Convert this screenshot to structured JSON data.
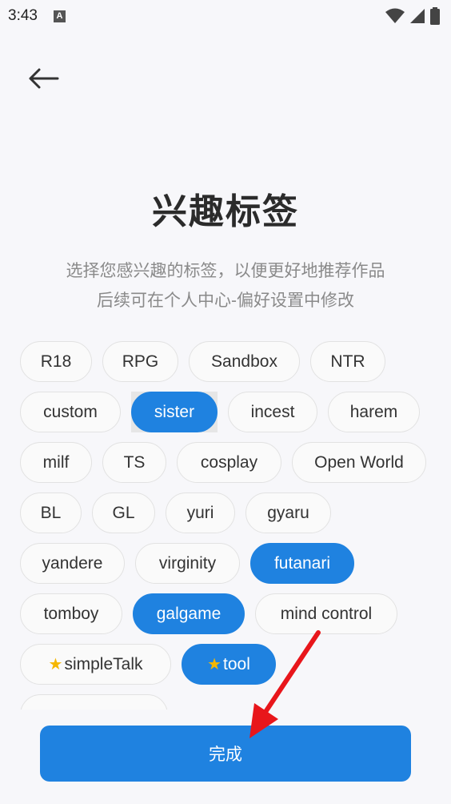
{
  "status": {
    "time": "3:43",
    "a_badge": "A"
  },
  "page": {
    "title": "兴趣标签",
    "subtitle_line1": "选择您感兴趣的标签，以便更好地推荐作品",
    "subtitle_line2": "后续可在个人中心-偏好设置中修改"
  },
  "tags": {
    "row1": [
      "R18",
      "RPG",
      "Sandbox",
      "NTR"
    ],
    "row2": [
      "custom",
      "sister",
      "incest",
      "harem"
    ],
    "row3": [
      "milf",
      "TS",
      "cosplay",
      "Open World"
    ],
    "row4": [
      "BL",
      "GL",
      "yuri",
      "gyaru"
    ],
    "row5": [
      "yandere",
      "virginity",
      "futanari"
    ],
    "row6": [
      "tomboy",
      "galgame",
      "mind control"
    ],
    "row7": [
      "simpleTalk",
      "tool"
    ]
  },
  "footer": {
    "done_label": "完成"
  },
  "colors": {
    "accent": "#1f82e0",
    "annotation_arrow": "#e8161b"
  }
}
